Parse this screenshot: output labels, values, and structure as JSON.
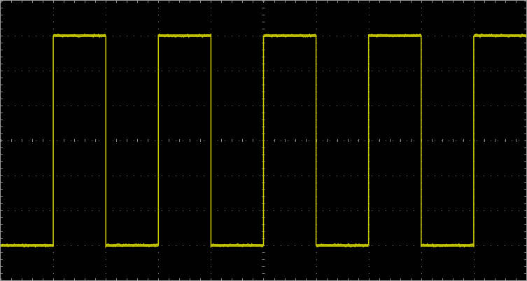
{
  "scope": {
    "background_color": "#000000",
    "grid_color": "#8a8a8a",
    "border_color": "#9a9a9a",
    "trace_color": "#c8c800",
    "divisions": {
      "horizontal": 10,
      "vertical": 8
    },
    "minor_ticks_per_division": 5
  },
  "waveform": {
    "type": "square",
    "cycles_on_screen": 5,
    "duty_cycle": 0.5,
    "starts_low": true,
    "high_level_div": 3.0,
    "low_level_div": -3.0,
    "first_rising_edge_div": 1.0,
    "period_div": 2.0,
    "noise_div": 0.04
  }
}
